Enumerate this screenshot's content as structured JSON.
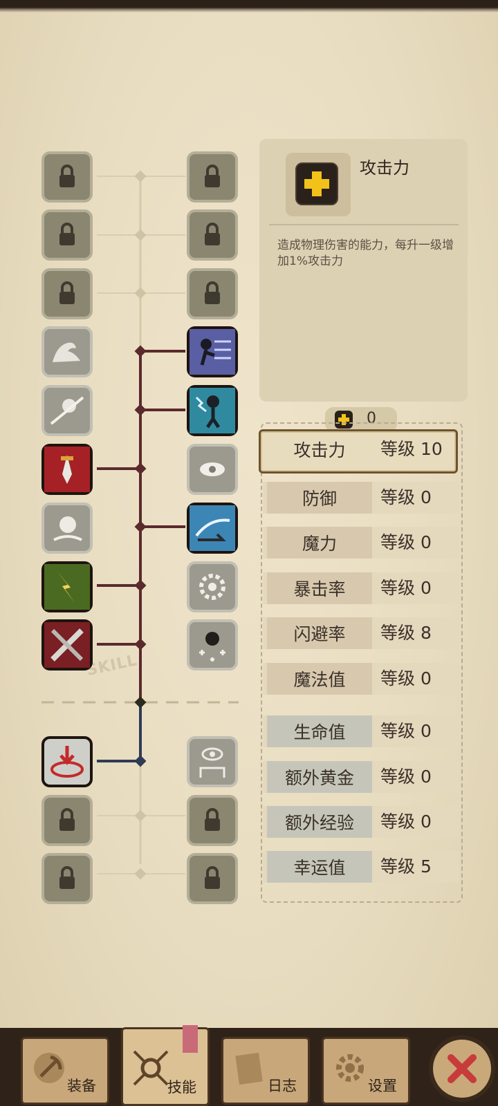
{
  "info": {
    "title": "攻击力",
    "description": "造成物理伤害的能力，每升一级增加1%攻击力",
    "icon": "plus-icon"
  },
  "skill_points": "0",
  "stats": [
    {
      "name": "攻击力",
      "level": "等级 10",
      "group": "warm",
      "selected": true
    },
    {
      "name": "防御",
      "level": "等级 0",
      "group": "warm"
    },
    {
      "name": "魔力",
      "level": "等级 0",
      "group": "warm"
    },
    {
      "name": "暴击率",
      "level": "等级 0",
      "group": "warm"
    },
    {
      "name": "闪避率",
      "level": "等级 8",
      "group": "warm"
    },
    {
      "name": "魔法值",
      "level": "等级 0",
      "group": "warm"
    },
    {
      "name": "生命值",
      "level": "等级 0",
      "group": "cool"
    },
    {
      "name": "额外黄金",
      "level": "等级 0",
      "group": "cool"
    },
    {
      "name": "额外经验",
      "level": "等级 0",
      "group": "cool"
    },
    {
      "name": "幸运值",
      "level": "等级 5",
      "group": "cool"
    }
  ],
  "skill_section_label": "SKILL",
  "nav": {
    "equipment": "装备",
    "skills": "技能",
    "log": "日志",
    "settings": "设置"
  },
  "colors": {
    "accent_yellow": "#f2c21b",
    "branch_red": "#5a2a2c",
    "branch_blue": "#2f3a55",
    "close_red": "#c83b3b"
  }
}
